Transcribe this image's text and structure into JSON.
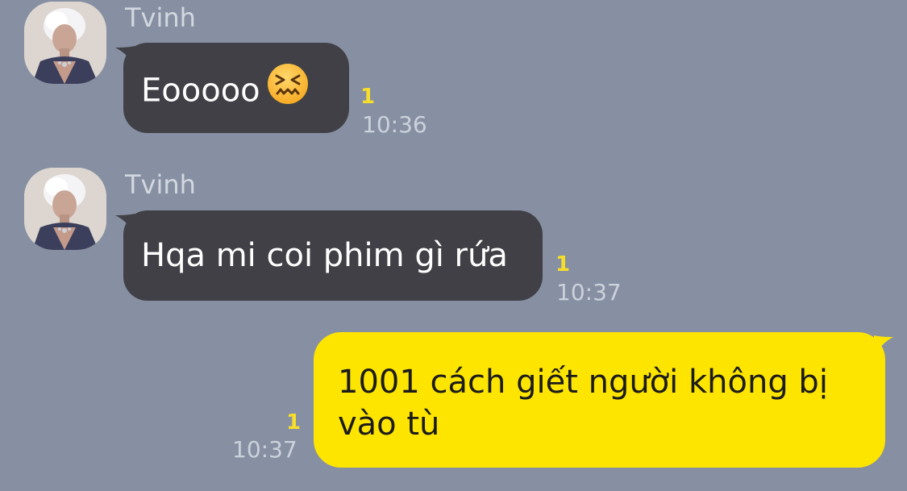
{
  "chat": {
    "messages": [
      {
        "sender": "Tvinh",
        "text": "Eooooo",
        "emoji": "confounded-face",
        "unread": "1",
        "time": "10:36",
        "direction": "incoming"
      },
      {
        "sender": "Tvinh",
        "text": "Hqa mi coi phim gì rứa",
        "unread": "1",
        "time": "10:37",
        "direction": "incoming"
      },
      {
        "text_line1": "1001 cách giết người không bị",
        "text_line2": "vào tù",
        "unread": "1",
        "time": "10:37",
        "direction": "outgoing"
      }
    ]
  },
  "colors": {
    "background": "#8690a2",
    "incoming_bubble": "#404046",
    "outgoing_bubble": "#fee500",
    "unread_count": "#f7de2a",
    "timestamp": "#ccd2db",
    "sender_name": "#d3d8e0"
  }
}
